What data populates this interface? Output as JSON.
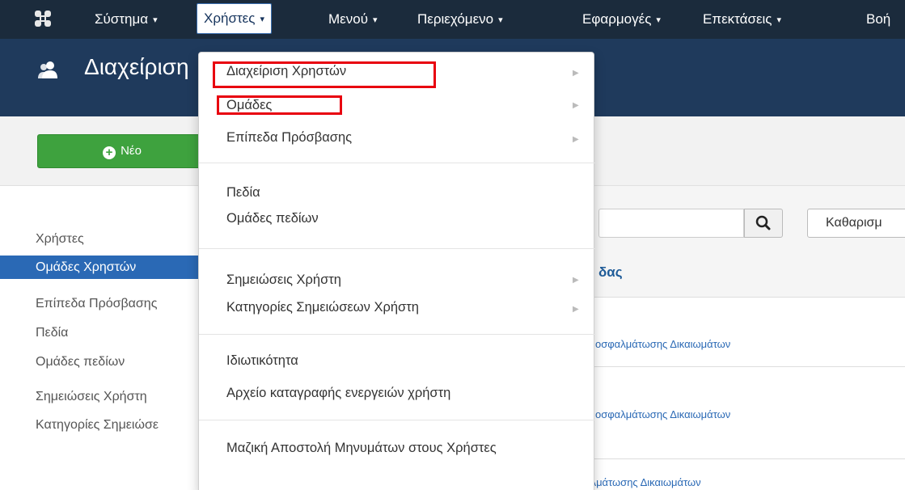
{
  "navbar": {
    "logo_icon": "joomla-logo-icon",
    "items": [
      {
        "label": "Σύστημα",
        "caret": "▾"
      },
      {
        "label": "Χρήστες",
        "caret": "▾"
      },
      {
        "label": "Μενού",
        "caret": "▾"
      },
      {
        "label": "Περιεχόμενο",
        "caret": "▾"
      },
      {
        "label": "Εφαρμογές",
        "caret": "▾"
      },
      {
        "label": "Επεκτάσεις",
        "caret": "▾"
      },
      {
        "label": "Βοή"
      }
    ]
  },
  "header": {
    "title": "Διαχείριση",
    "icon": "users-icon"
  },
  "toolbar": {
    "new_label": "Νέο",
    "new_icon": "plus-circle-icon"
  },
  "sidebar": {
    "items": [
      {
        "label": "Χρήστες"
      },
      {
        "label": "Ομάδες Χρηστών"
      },
      {
        "label": "Επίπεδα Πρόσβασης"
      },
      {
        "label": "Πεδία"
      },
      {
        "label": "Ομάδες πεδίων"
      },
      {
        "label": "Σημειώσεις Χρήστη"
      },
      {
        "label": "Κατηγορίες Σημειώσε"
      }
    ]
  },
  "main": {
    "search_icon": "search-icon",
    "clear_label": "Καθαρισμ",
    "column_header": "δας",
    "rows": [
      {
        "link": "οσφαλμάτωσης Δικαιωμάτων"
      },
      {
        "link": "οσφαλμάτωσης Δικαιωμάτων"
      },
      {
        "link": "Αναφορά Αποσφαλμάτωσης Δικαιωμάτων"
      }
    ]
  },
  "dropdown": {
    "items": [
      {
        "label": "Διαχείριση Χρηστών",
        "has_submenu": true
      },
      {
        "label": "Ομάδες",
        "has_submenu": true
      },
      {
        "label": "Επίπεδα Πρόσβασης",
        "has_submenu": true
      },
      {
        "label": "Πεδία"
      },
      {
        "label": "Ομάδες πεδίων"
      },
      {
        "label": "Σημειώσεις Χρήστη",
        "has_submenu": true
      },
      {
        "label": "Κατηγορίες Σημειώσεων Χρήστη",
        "has_submenu": true
      },
      {
        "label": "Ιδιωτικότητα"
      },
      {
        "label": "Αρχείο καταγραφής ενεργειών χρήστη"
      },
      {
        "label": "Μαζική Αποστολή Μηνυμάτων στους Χρήστες"
      }
    ],
    "submenu_arrow": "▶",
    "highlight_color": "#e8000f"
  },
  "colors": {
    "navbar_bg": "#1b2b3c",
    "header_bg": "#1f3a5c",
    "active_sidebar": "#2a69b5",
    "new_button": "#3ea23e"
  }
}
